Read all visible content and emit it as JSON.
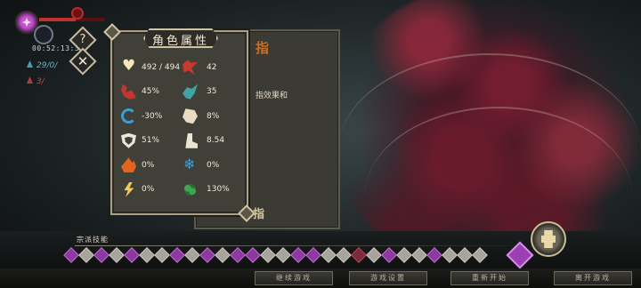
{
  "hud": {
    "timer": "00:52:13:34",
    "stat_a": "29/0/",
    "stat_b": "3/",
    "help_symbol": "?",
    "close_symbol": "✕",
    "hp_fraction": 0.55
  },
  "guide_panel": {
    "title": "指",
    "line_prefix": "指",
    "line_highlight": "效果和",
    "bottom_char": "指"
  },
  "attributes": {
    "title": "角色属性",
    "rows": [
      [
        {
          "icon": "heart-icon",
          "value": "492 / 494"
        },
        {
          "icon": "sword-icon",
          "value": "42"
        }
      ],
      [
        {
          "icon": "claw-icon",
          "value": "45%"
        },
        {
          "icon": "wing-icon",
          "value": "35"
        }
      ],
      [
        {
          "icon": "swirl-icon",
          "value": "-30%"
        },
        {
          "icon": "fist-icon",
          "value": "8%"
        }
      ],
      [
        {
          "icon": "shield-icon",
          "value": "51%"
        },
        {
          "icon": "boot-icon",
          "value": "8.54"
        }
      ],
      [
        {
          "icon": "fire-icon",
          "value": "0%"
        },
        {
          "icon": "snowflake-icon",
          "value": "0%"
        }
      ],
      [
        {
          "icon": "lightning-icon",
          "value": "0%"
        },
        {
          "icon": "poison-icon",
          "value": "130%"
        }
      ]
    ]
  },
  "skills": {
    "label": "宗派技能",
    "count": 28
  },
  "buttons": {
    "continue": "继续游戏",
    "settings": "游戏设置",
    "restart": "重新开始",
    "quit": "离开游戏"
  },
  "colors": {
    "hp": "#c23131",
    "panel_bg": "#403f38",
    "panel_border": "#aaa186",
    "skill_purple": "#8d3aa0",
    "guide_orange": "#c8702a"
  }
}
